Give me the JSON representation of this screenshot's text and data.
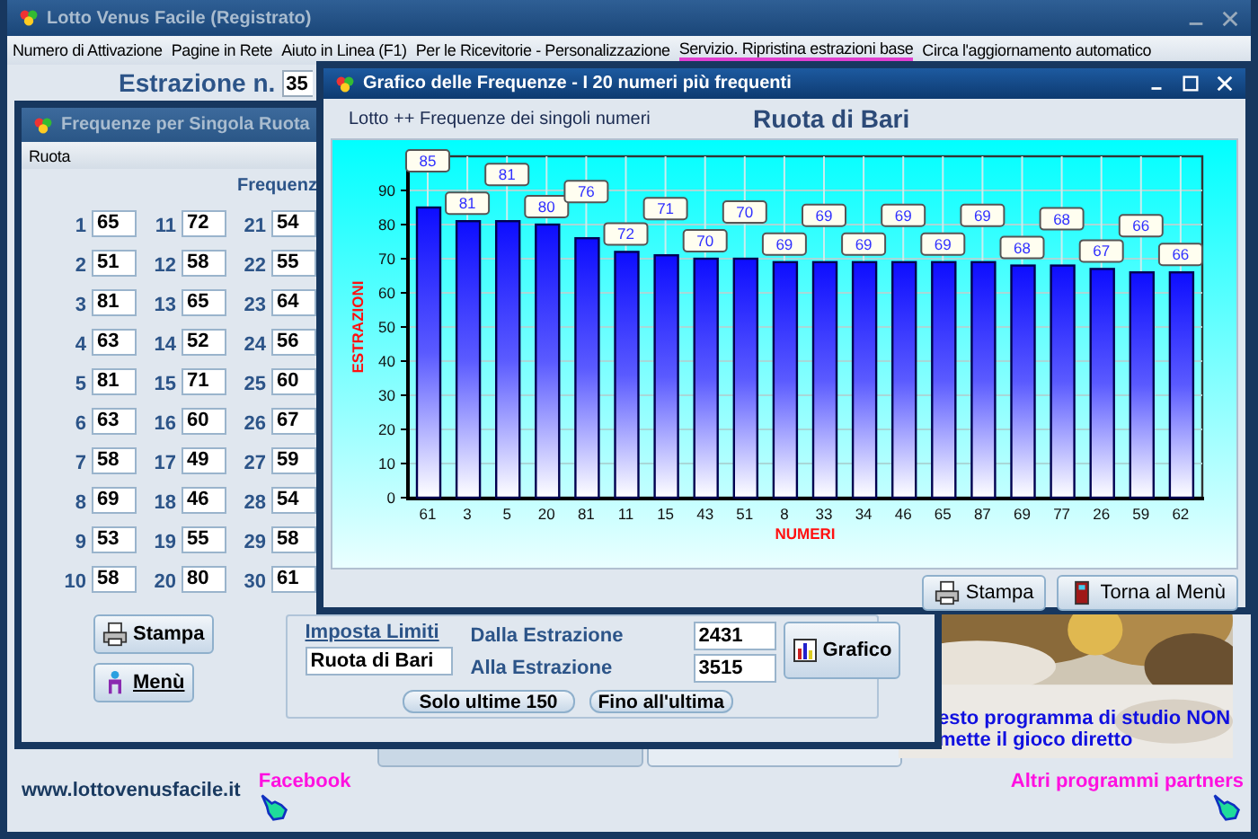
{
  "main_window": {
    "title": "Lotto Venus Facile (Registrato)"
  },
  "menu": [
    {
      "label": "Numero di Attivazione",
      "selected": false
    },
    {
      "label": "Pagine in Rete",
      "selected": false
    },
    {
      "label": "Aiuto in Linea (F1)",
      "selected": false
    },
    {
      "label": "Per le Ricevitorie - Personalizzazione",
      "selected": false
    },
    {
      "label": "Servizio. Ripristina estrazioni base",
      "selected": true
    },
    {
      "label": "Circa l'aggiornamento automatico",
      "selected": false
    }
  ],
  "estrazione": {
    "label": "Estrazione n.",
    "value": "35"
  },
  "frequency_window": {
    "title": "Frequenze per Singola Ruota",
    "menu": "Ruota",
    "header": "Frequenz",
    "cells": [
      {
        "number": "1",
        "value": "65"
      },
      {
        "number": "2",
        "value": "51"
      },
      {
        "number": "3",
        "value": "81"
      },
      {
        "number": "4",
        "value": "63"
      },
      {
        "number": "5",
        "value": "81"
      },
      {
        "number": "6",
        "value": "63"
      },
      {
        "number": "7",
        "value": "58"
      },
      {
        "number": "8",
        "value": "69"
      },
      {
        "number": "9",
        "value": "53"
      },
      {
        "number": "10",
        "value": "58"
      },
      {
        "number": "11",
        "value": "72"
      },
      {
        "number": "12",
        "value": "58"
      },
      {
        "number": "13",
        "value": "65"
      },
      {
        "number": "14",
        "value": "52"
      },
      {
        "number": "15",
        "value": "71"
      },
      {
        "number": "16",
        "value": "60"
      },
      {
        "number": "17",
        "value": "49"
      },
      {
        "number": "18",
        "value": "46"
      },
      {
        "number": "19",
        "value": "55"
      },
      {
        "number": "20",
        "value": "80"
      },
      {
        "number": "21",
        "value": "54"
      },
      {
        "number": "22",
        "value": "55"
      },
      {
        "number": "23",
        "value": "64"
      },
      {
        "number": "24",
        "value": "56"
      },
      {
        "number": "25",
        "value": "60"
      },
      {
        "number": "26",
        "value": "67"
      },
      {
        "number": "27",
        "value": "59"
      },
      {
        "number": "28",
        "value": "54"
      },
      {
        "number": "29",
        "value": "58"
      },
      {
        "number": "30",
        "value": "61"
      }
    ],
    "print_button": "Stampa",
    "menu_button": "Menù",
    "limits": {
      "title": "Imposta Limiti",
      "ruota": "Ruota di Bari",
      "from_label": "Dalla Estrazione",
      "from": "2431",
      "to_label": "Alla Estrazione",
      "to": "3515",
      "last_button": "Solo ultime 150",
      "end_button": "Fino all'ultima"
    },
    "chart_button": "Grafico"
  },
  "chart_window": {
    "title": "Grafico delle Frequenze - I 20 numeri più frequenti",
    "subtitle": "Lotto ++ Frequenze dei singoli numeri",
    "chart_data": {
      "type": "bar",
      "title": "Ruota di Bari",
      "xlabel": "NUMERI",
      "ylabel": "ESTRAZIONI",
      "categories": [
        "61",
        "3",
        "5",
        "20",
        "81",
        "11",
        "15",
        "43",
        "51",
        "8",
        "33",
        "34",
        "46",
        "65",
        "87",
        "69",
        "77",
        "26",
        "59",
        "62"
      ],
      "values": [
        85,
        81,
        81,
        80,
        76,
        72,
        71,
        70,
        70,
        69,
        69,
        69,
        69,
        69,
        69,
        68,
        68,
        67,
        66,
        66
      ],
      "ylim": [
        0,
        100
      ],
      "yticks": [
        0,
        10,
        20,
        30,
        40,
        50,
        60,
        70,
        80,
        90
      ],
      "grid": true,
      "data_labels": true
    },
    "print_button": "Stampa",
    "back_button": "Torna al Menù"
  },
  "ad": {
    "kind": "picture",
    "lines": [
      "esto programma di studio NON",
      "mette il gioco diretto"
    ]
  },
  "footer": {
    "website": "www.lottovenusfacile.it",
    "facebook": "Facebook",
    "partners": "Altri programmi partners"
  }
}
